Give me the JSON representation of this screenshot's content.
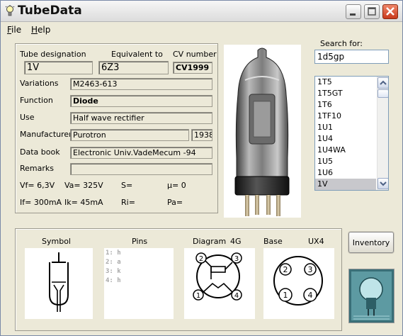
{
  "window": {
    "title": "TubeData"
  },
  "menu": {
    "file": "File",
    "file_key": "F",
    "file_rest": "ile",
    "help": "Help",
    "help_key": "H",
    "help_rest": "elp"
  },
  "labels": {
    "tube_designation": "Tube designation",
    "equivalent_to": "Equivalent to",
    "cv_number": "CV number",
    "variations": "Variations",
    "function": "Function",
    "use": "Use",
    "manufacturer": "Manufacturer",
    "data_book": "Data book",
    "remarks": "Remarks",
    "search_for": "Search for:",
    "symbol": "Symbol",
    "pins": "Pins",
    "diagram": "Diagram",
    "base": "Base"
  },
  "tube": {
    "designation": "1V",
    "equivalent": "6Z3",
    "cv_number": "CV1999",
    "variations": "M2463-613",
    "function": "Diode",
    "use": "Half wave rectifier",
    "manufacturer": "Purotron",
    "year": "1938",
    "data_book": "Electronic Univ.VadeMecum -94",
    "remarks": "",
    "vf": "Vf= 6,3V",
    "va": "Va=  325V",
    "s": "S=",
    "mu": "µ=    0",
    "if": "If= 300mA",
    "ik": "Ik=   45mA",
    "ri": "Ri=",
    "pa": "Pa=",
    "diagram_code": "4G",
    "base_code": "UX4"
  },
  "pins": [
    "1: h",
    "2: a",
    "3: k",
    "4: h"
  ],
  "search": {
    "value": "1d5gp"
  },
  "list": {
    "items": [
      "1T5",
      "1T5GT",
      "1T6",
      "1TF10",
      "1U1",
      "1U4",
      "1U4WA",
      "1U5",
      "1U6",
      "1V"
    ],
    "selected_index": 9
  },
  "buttons": {
    "inventory": "Inventory"
  },
  "icons": {
    "app": "lightbulb-icon",
    "minimize": "minimize-icon",
    "maximize": "maximize-icon",
    "close": "close-icon"
  },
  "colors": {
    "close_button": "#d04a2a",
    "selection": "#c8c8cc"
  }
}
